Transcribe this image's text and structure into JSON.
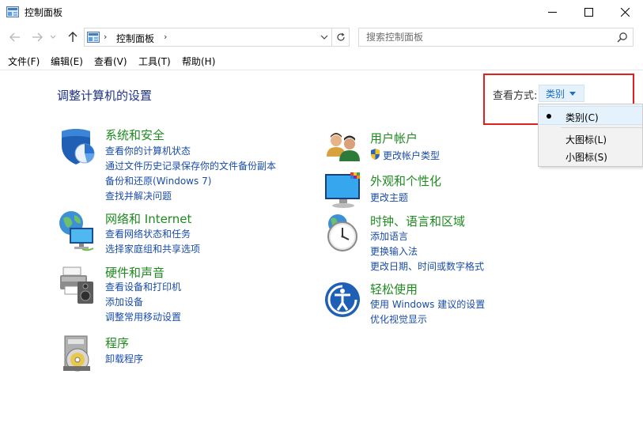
{
  "window": {
    "title": "控制面板"
  },
  "address": {
    "path": "控制面板",
    "search_placeholder": "搜索控制面板"
  },
  "menubar": {
    "items": [
      "文件(F)",
      "编辑(E)",
      "查看(V)",
      "工具(T)",
      "帮助(H)"
    ]
  },
  "main": {
    "heading": "调整计算机的设置",
    "view_by": {
      "label": "查看方式:",
      "selected": "类别",
      "options": [
        "类别(C)",
        "大图标(L)",
        "小图标(S)"
      ]
    },
    "categories": [
      {
        "title": "系统和安全",
        "icon": "shield-icon",
        "links": [
          "查看你的计算机状态",
          "通过文件历史记录保存你的文件备份副本",
          "备份和还原(Windows 7)",
          "查找并解决问题"
        ]
      },
      {
        "title": "网络和 Internet",
        "icon": "network-globe-icon",
        "links": [
          "查看网络状态和任务",
          "选择家庭组和共享选项"
        ]
      },
      {
        "title": "硬件和声音",
        "icon": "printer-speaker-icon",
        "links": [
          "查看设备和打印机",
          "添加设备",
          "调整常用移动设置"
        ]
      },
      {
        "title": "程序",
        "icon": "programs-disc-icon",
        "links": [
          "卸载程序"
        ]
      },
      {
        "title": "用户帐户",
        "icon": "users-icon",
        "links": [
          "更改帐户类型"
        ]
      },
      {
        "title": "外观和个性化",
        "icon": "monitor-paint-icon",
        "links": [
          "更改主题"
        ]
      },
      {
        "title": "时钟、语言和区域",
        "icon": "clock-globe-icon",
        "links": [
          "添加语言",
          "更换输入法",
          "更改日期、时间或数字格式"
        ]
      },
      {
        "title": "轻松使用",
        "icon": "accessibility-icon",
        "links": [
          "使用 Windows 建议的设置",
          "优化视觉显示"
        ]
      }
    ]
  },
  "colors": {
    "accent_link": "#1a4ca8",
    "category_title": "#1e8b1e",
    "heading": "#1e3287",
    "highlight": "#e02020"
  }
}
